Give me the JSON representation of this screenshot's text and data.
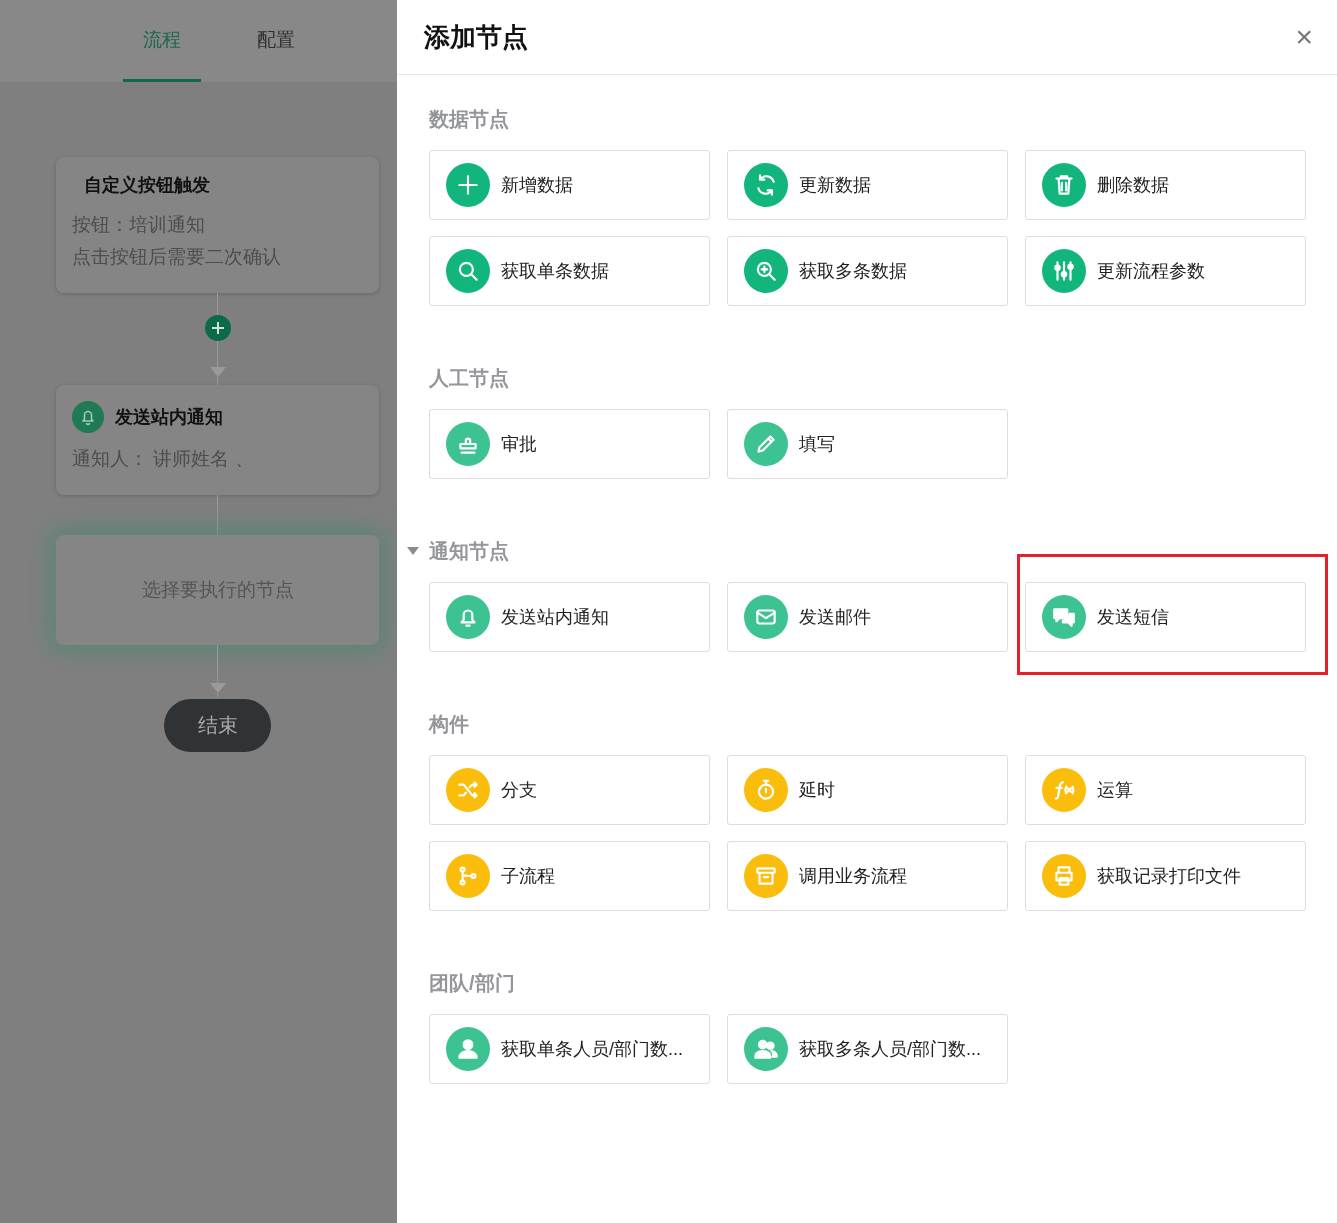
{
  "tabs": [
    {
      "label": "流程",
      "selected": true
    },
    {
      "label": "配置",
      "selected": false
    }
  ],
  "flow": [
    {
      "kind": "trigger",
      "title": "自定义按钮触发",
      "lines": [
        "按钮：培训通知",
        "点击按钮后需要二次确认"
      ],
      "selected": false,
      "add_after": true
    },
    {
      "kind": "action",
      "title": "发送站内通知",
      "lines": [
        "通知人：  讲师姓名 、"
      ],
      "selected": false,
      "add_after": false
    },
    {
      "kind": "placeholder",
      "title": "选择要执行的节点",
      "selected": true,
      "add_after": false
    },
    {
      "kind": "end",
      "title": "结束",
      "selected": false,
      "add_after": false
    }
  ],
  "drawer": {
    "title": "添加节点",
    "close": "×"
  },
  "sections": [
    {
      "title": "数据节点",
      "caret": false,
      "items": [
        {
          "label": "新增数据",
          "color": "#12b57b",
          "highlighted": false
        },
        {
          "label": "更新数据",
          "color": "#12b57b",
          "highlighted": false
        },
        {
          "label": "删除数据",
          "color": "#12b57b",
          "highlighted": false
        },
        {
          "label": "获取单条数据",
          "color": "#12b57b",
          "highlighted": false
        },
        {
          "label": "获取多条数据",
          "color": "#12b57b",
          "highlighted": false
        },
        {
          "label": "更新流程参数",
          "color": "#12b57b",
          "highlighted": false
        }
      ]
    },
    {
      "title": "人工节点",
      "caret": false,
      "items": [
        {
          "label": "审批",
          "color": "#3cc391",
          "highlighted": false
        },
        {
          "label": "填写",
          "color": "#3cc391",
          "highlighted": false
        }
      ]
    },
    {
      "title": "通知节点",
      "caret": true,
      "items": [
        {
          "label": "发送站内通知",
          "color": "#3cc391",
          "highlighted": false
        },
        {
          "label": "发送邮件",
          "color": "#3cc391",
          "highlighted": false
        },
        {
          "label": "发送短信",
          "color": "#3cc391",
          "highlighted": true
        }
      ]
    },
    {
      "title": "构件",
      "caret": false,
      "items": [
        {
          "label": "分支",
          "color": "#fbbd0c",
          "highlighted": false
        },
        {
          "label": "延时",
          "color": "#fbbd0c",
          "highlighted": false
        },
        {
          "label": "运算",
          "color": "#fbbd0c",
          "highlighted": false
        },
        {
          "label": "子流程",
          "color": "#fbbd0c",
          "highlighted": false
        },
        {
          "label": "调用业务流程",
          "color": "#fbbd0c",
          "highlighted": false
        },
        {
          "label": "获取记录打印文件",
          "color": "#fbbd0c",
          "highlighted": false
        }
      ]
    },
    {
      "title": "团队/部门",
      "caret": false,
      "items": [
        {
          "label": "获取单条人员/部门数...",
          "color": "#3cc391",
          "highlighted": false
        },
        {
          "label": "获取多条人员/部门数...",
          "color": "#3cc391",
          "highlighted": false
        }
      ]
    }
  ]
}
